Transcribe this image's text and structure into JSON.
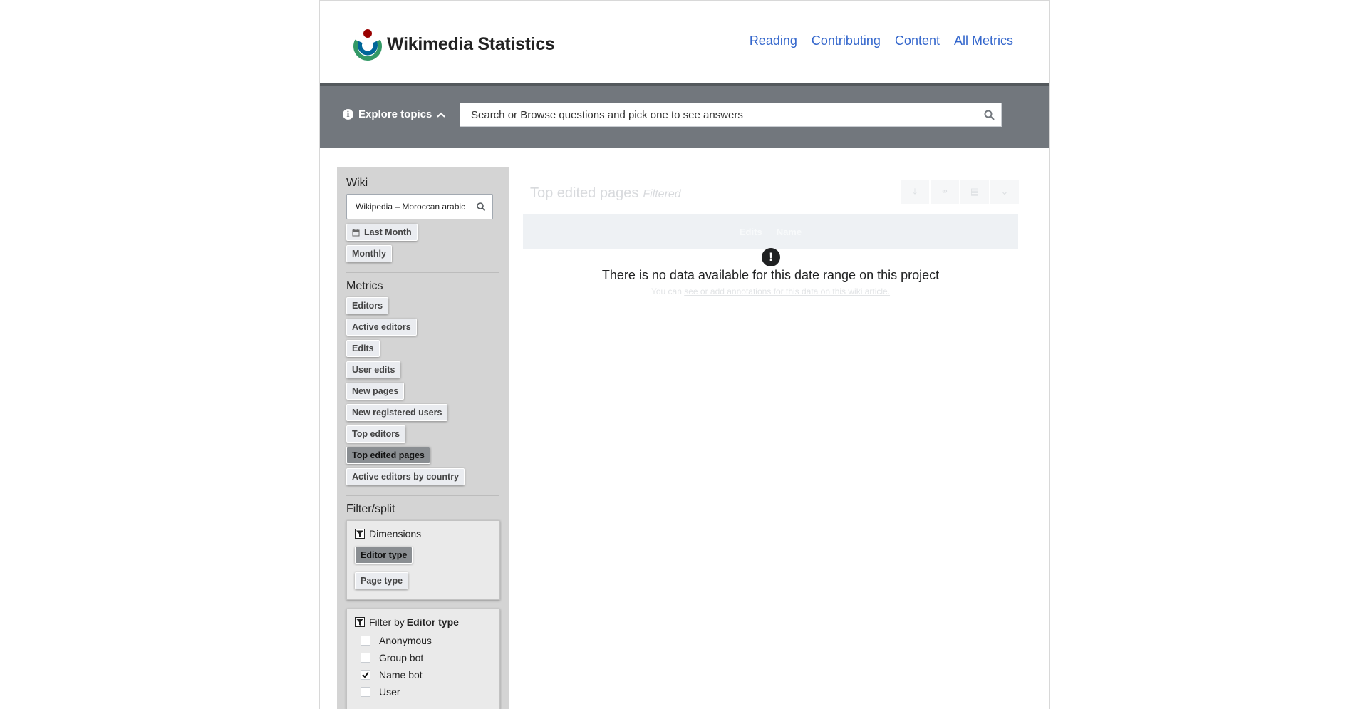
{
  "header": {
    "logo_text": "Wikimedia Statistics",
    "nav": [
      "Reading",
      "Contributing",
      "Content",
      "All Metrics"
    ]
  },
  "explore": {
    "label": "Explore topics",
    "search_placeholder": "Search or Browse questions and pick one to see answers"
  },
  "sidebar": {
    "wiki_title": "Wiki",
    "wiki_value": "Wikipedia – Moroccan arabic",
    "time_range": "Last Month",
    "granularity": "Monthly",
    "metrics_title": "Metrics",
    "metrics": [
      "Editors",
      "Active editors",
      "Edits",
      "User edits",
      "New pages",
      "New registered users",
      "Top editors",
      "Top edited pages",
      "Active editors by country"
    ],
    "active_metric": "Top edited pages",
    "filter_title": "Filter/split",
    "dimensions_title": "Dimensions",
    "dimensions": [
      "Editor type",
      "Page type"
    ],
    "active_dimension": "Editor type",
    "filter_by_prefix": "Filter by",
    "filter_by_value": "Editor type",
    "filter_options": [
      {
        "label": "Anonymous",
        "checked": false
      },
      {
        "label": "Group bot",
        "checked": false
      },
      {
        "label": "Name bot",
        "checked": true
      },
      {
        "label": "User",
        "checked": false
      }
    ]
  },
  "main": {
    "title": "Top edited pages",
    "title_tag": "Filtered",
    "col_edits": "Edits",
    "col_name": "Name",
    "no_data": "There is no data available for this date range on this project",
    "sub_prefix": "You can ",
    "sub_link": "see or add annotations for this data on this wiki article."
  },
  "colors": {
    "link": "#3366cc",
    "explore_bar": "#72777d",
    "sidebar": "#d4d4d4"
  }
}
